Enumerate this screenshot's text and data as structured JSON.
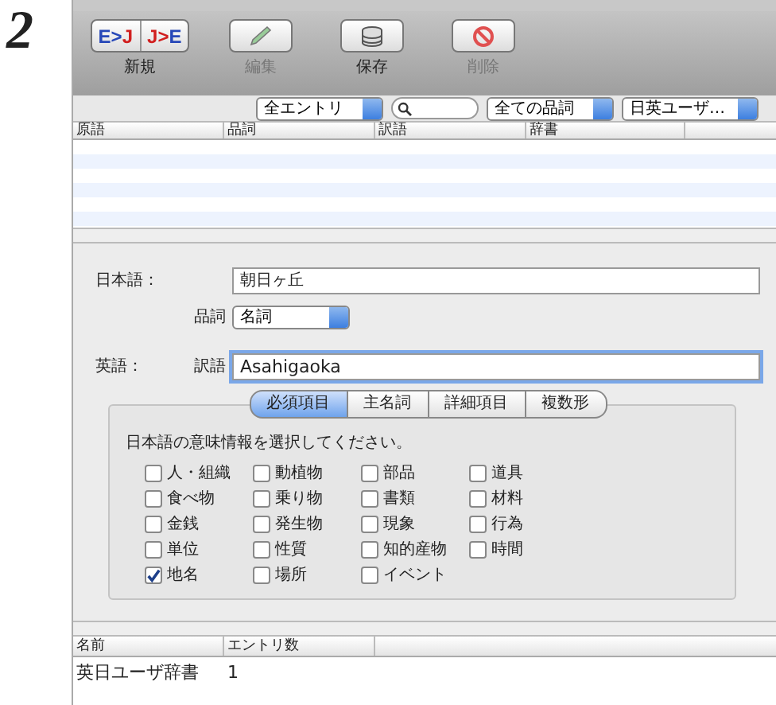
{
  "step": "2",
  "toolbar": [
    {
      "kind": "segment",
      "label": "新規",
      "disabled": false,
      "segments": [
        [
          {
            "text": "E",
            "color": "#2748b8"
          },
          {
            "text": ">",
            "color": "#2748b8"
          },
          {
            "text": "J",
            "color": "#d11f1f"
          }
        ],
        [
          {
            "text": "J",
            "color": "#d11f1f"
          },
          {
            "text": ">",
            "color": "#d11f1f"
          },
          {
            "text": "E",
            "color": "#2748b8"
          }
        ]
      ]
    },
    {
      "kind": "edit",
      "label": "編集",
      "disabled": true
    },
    {
      "kind": "save",
      "label": "保存",
      "disabled": false
    },
    {
      "kind": "delete",
      "label": "削除",
      "disabled": true
    }
  ],
  "filters": {
    "entries": "全エントリ",
    "part_of_speech": "全ての品詞",
    "dictionary": "日英ユーザ…"
  },
  "entries_table": {
    "columns": [
      "原語",
      "品詞",
      "訳語",
      "辞書"
    ]
  },
  "form": {
    "japanese_label": "日本語：",
    "japanese_value": "朝日ヶ丘",
    "pos_label": "品詞",
    "pos_value": "名詞",
    "english_label": "英語：",
    "translation_label": "訳語",
    "translation_value": "Asahigaoka",
    "translation_focused": true
  },
  "tabs": [
    {
      "label": "必須項目",
      "selected": true
    },
    {
      "label": "主名詞",
      "selected": false
    },
    {
      "label": "詳細項目",
      "selected": false
    },
    {
      "label": "複数形",
      "selected": false
    }
  ],
  "instruction": "日本語の意味情報を選択してください。",
  "categories": [
    {
      "label": "人・組織",
      "checked": false
    },
    {
      "label": "動植物",
      "checked": false
    },
    {
      "label": "部品",
      "checked": false
    },
    {
      "label": "道具",
      "checked": false
    },
    {
      "label": "食べ物",
      "checked": false
    },
    {
      "label": "乗り物",
      "checked": false
    },
    {
      "label": "書類",
      "checked": false
    },
    {
      "label": "材料",
      "checked": false
    },
    {
      "label": "金銭",
      "checked": false
    },
    {
      "label": "発生物",
      "checked": false
    },
    {
      "label": "現象",
      "checked": false
    },
    {
      "label": "行為",
      "checked": false
    },
    {
      "label": "単位",
      "checked": false
    },
    {
      "label": "性質",
      "checked": false
    },
    {
      "label": "知的産物",
      "checked": false
    },
    {
      "label": "時間",
      "checked": false
    },
    {
      "label": "地名",
      "checked": true
    },
    {
      "label": "場所",
      "checked": false
    },
    {
      "label": "イベント",
      "checked": false
    }
  ],
  "dictionary_table": {
    "columns": [
      "名前",
      "エントリ数"
    ],
    "rows": [
      [
        "英日ユーザ辞書",
        "1"
      ]
    ]
  }
}
